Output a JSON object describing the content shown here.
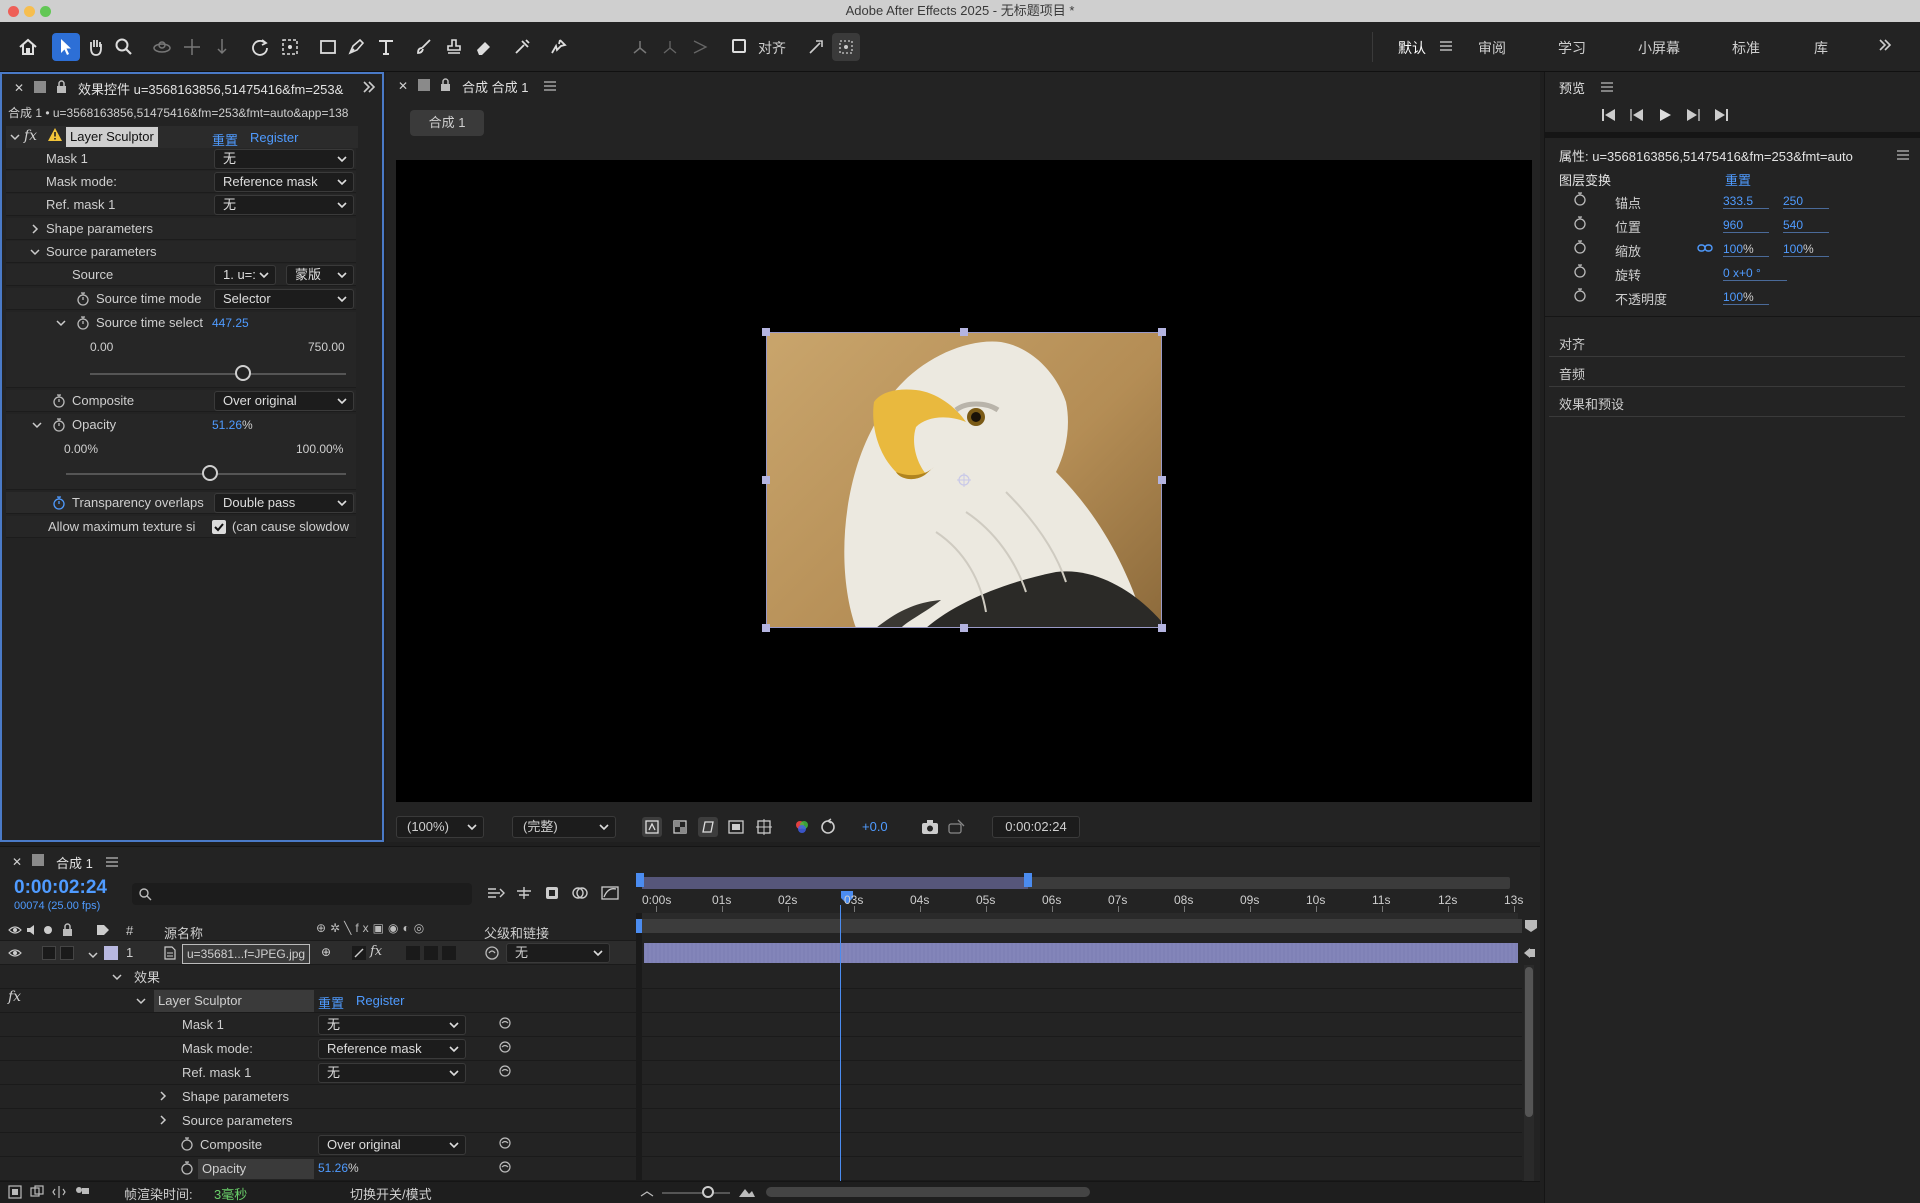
{
  "window": {
    "title": "Adobe After Effects 2025 - 无标题项目 *"
  },
  "toolbar": {
    "snap_label": "对齐",
    "workspaces": [
      "默认",
      "审阅",
      "学习",
      "小屏幕",
      "标准",
      "库"
    ]
  },
  "effects_panel": {
    "tab_title": "效果控件 u=3568163856,51475416&fm=253&",
    "breadcrumb": "合成 1 • u=3568163856,51475416&fm=253&fmt=auto&app=138",
    "effect_name": "Layer Sculptor",
    "reset": "重置",
    "register": "Register",
    "mask1_label": "Mask 1",
    "mask1_value": "无",
    "mask_mode_label": "Mask mode:",
    "mask_mode_value": "Reference mask",
    "ref_mask_label": "Ref. mask 1",
    "ref_mask_value": "无",
    "shape_params": "Shape parameters",
    "source_params": "Source parameters",
    "source_label": "Source",
    "source_value": "1. u=:",
    "source_value2": "蒙版",
    "source_time_mode_label": "Source time mode",
    "source_time_mode_value": "Selector",
    "source_time_select_label": "Source time select",
    "source_time_select_value": "447.25",
    "source_time_min": "0.00",
    "source_time_max": "750.00",
    "source_time_position": 0.596,
    "composite_label": "Composite",
    "composite_value": "Over original",
    "opacity_label": "Opacity",
    "opacity_value": "51.26",
    "opacity_unit": "%",
    "opacity_min": "0.00%",
    "opacity_max": "100.00%",
    "opacity_position": 0.5126,
    "transparency_label": "Transparency overlaps",
    "transparency_value": "Double pass",
    "allow_texture_label": "Allow maximum texture si",
    "allow_texture_value": "(can cause slowdow",
    "allow_texture_checked": true
  },
  "comp_panel": {
    "tab_title": "合成 合成 1",
    "comp_button": "合成 1",
    "zoom": "(100%)",
    "quality": "(完整)",
    "exposure": "+0.0",
    "timecode": "0:00:02:24"
  },
  "right_panel": {
    "preview_title": "预览",
    "properties_title": "属性: u=3568163856,51475416&fm=253&fmt=auto",
    "layer_transform": "图层变换",
    "reset": "重置",
    "props": [
      {
        "label": "锚点",
        "v1": "333.5",
        "v2": "250",
        "unit1": "",
        "unit2": ""
      },
      {
        "label": "位置",
        "v1": "960",
        "v2": "540",
        "unit1": "",
        "unit2": ""
      },
      {
        "label": "缩放",
        "v1": "100",
        "v2": "100",
        "unit1": "%",
        "unit2": "%"
      },
      {
        "label": "旋转",
        "v1": "0",
        "v2": "",
        "unit1": "x",
        "unit2": "+0 °"
      },
      {
        "label": "不透明度",
        "v1": "100",
        "v2": "",
        "unit1": "%",
        "unit2": ""
      }
    ],
    "sections": [
      "对齐",
      "音频",
      "效果和预设"
    ]
  },
  "timeline": {
    "tab_title": "合成 1",
    "timecode": "0:00:02:24",
    "frame_info": "00074 (25.00 fps)",
    "col_num": "#",
    "col_source": "源名称",
    "col_parent": "父级和链接",
    "layer_num": "1",
    "layer_name": "u=35681...f=JPEG.jpg",
    "layer_parent": "无",
    "effects_group": "效果",
    "effect_name": "Layer Sculptor",
    "reset": "重置",
    "register": "Register",
    "mask1_label": "Mask 1",
    "mask1_value": "无",
    "mask_mode_label": "Mask mode:",
    "mask_mode_value": "Reference mask",
    "ref_mask_label": "Ref. mask 1",
    "ref_mask_value": "无",
    "shape_params": "Shape parameters",
    "source_params": "Source parameters",
    "composite_label": "Composite",
    "composite_value": "Over original",
    "opacity_label": "Opacity",
    "opacity_value": "51.26",
    "opacity_unit": "%",
    "ruler": [
      "0:00s",
      "01s",
      "02s",
      "03s",
      "04s",
      "05s",
      "06s",
      "07s",
      "08s",
      "09s",
      "10s",
      "11s",
      "12s",
      "13s"
    ],
    "render_time_label": "帧渲染时间:",
    "render_time_value": "3毫秒",
    "toggle_mode": "切换开关/模式"
  },
  "colors": {
    "accent": "#2d6fd6",
    "link": "#4f9bff",
    "layer_bar": "#7d7fb4",
    "playhead": "#4b8cf0"
  }
}
